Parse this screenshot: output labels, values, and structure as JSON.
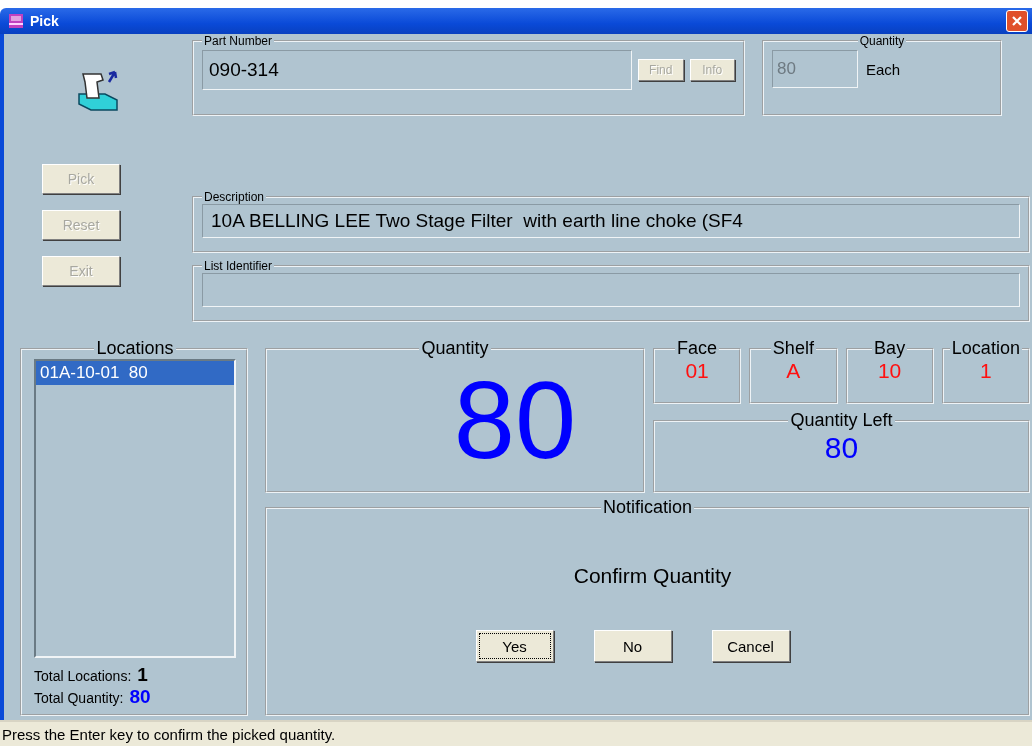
{
  "window": {
    "title": "Pick"
  },
  "actions": [
    {
      "label": "Pick",
      "disabled": true
    },
    {
      "label": "Reset",
      "disabled": true
    },
    {
      "label": "Exit",
      "disabled": true
    }
  ],
  "part_number": {
    "label": "Part Number",
    "value": "090-314",
    "buttons": [
      {
        "label": "Find",
        "disabled": true
      },
      {
        "label": "Info",
        "disabled": true
      }
    ]
  },
  "order_quantity": {
    "label": "Quantity",
    "value": "80",
    "disabled": true,
    "unit": "Each"
  },
  "description": {
    "label": "Description",
    "value": "10A BELLING LEE Two Stage Filter  with earth line choke (SF4"
  },
  "list_identifier": {
    "label": "List Identifier"
  },
  "locations": {
    "label": "Locations",
    "items": [
      {
        "text": "01A-10-01  80",
        "selected": true
      }
    ],
    "totals": [
      {
        "label": "Total Locations:",
        "value": "1",
        "color": "#000000"
      },
      {
        "label": "Total Quantity:",
        "value": "80",
        "color": "#0000ff"
      }
    ]
  },
  "quantity": {
    "label": "Quantity",
    "value": "80"
  },
  "position": [
    {
      "label": "Face",
      "value": "01"
    },
    {
      "label": "Shelf",
      "value": "A"
    },
    {
      "label": "Bay",
      "value": "10"
    },
    {
      "label": "Location",
      "value": "1"
    }
  ],
  "quantity_left": {
    "label": "Quantity Left",
    "value": "80"
  },
  "notification": {
    "label": "Notification",
    "message": "Confirm Quantity",
    "buttons": [
      {
        "label": "Yes",
        "focused": true
      },
      {
        "label": "No",
        "focused": false
      },
      {
        "label": "Cancel",
        "focused": false
      }
    ]
  },
  "status_bar": "Press the Enter key to confirm the picked quantity."
}
